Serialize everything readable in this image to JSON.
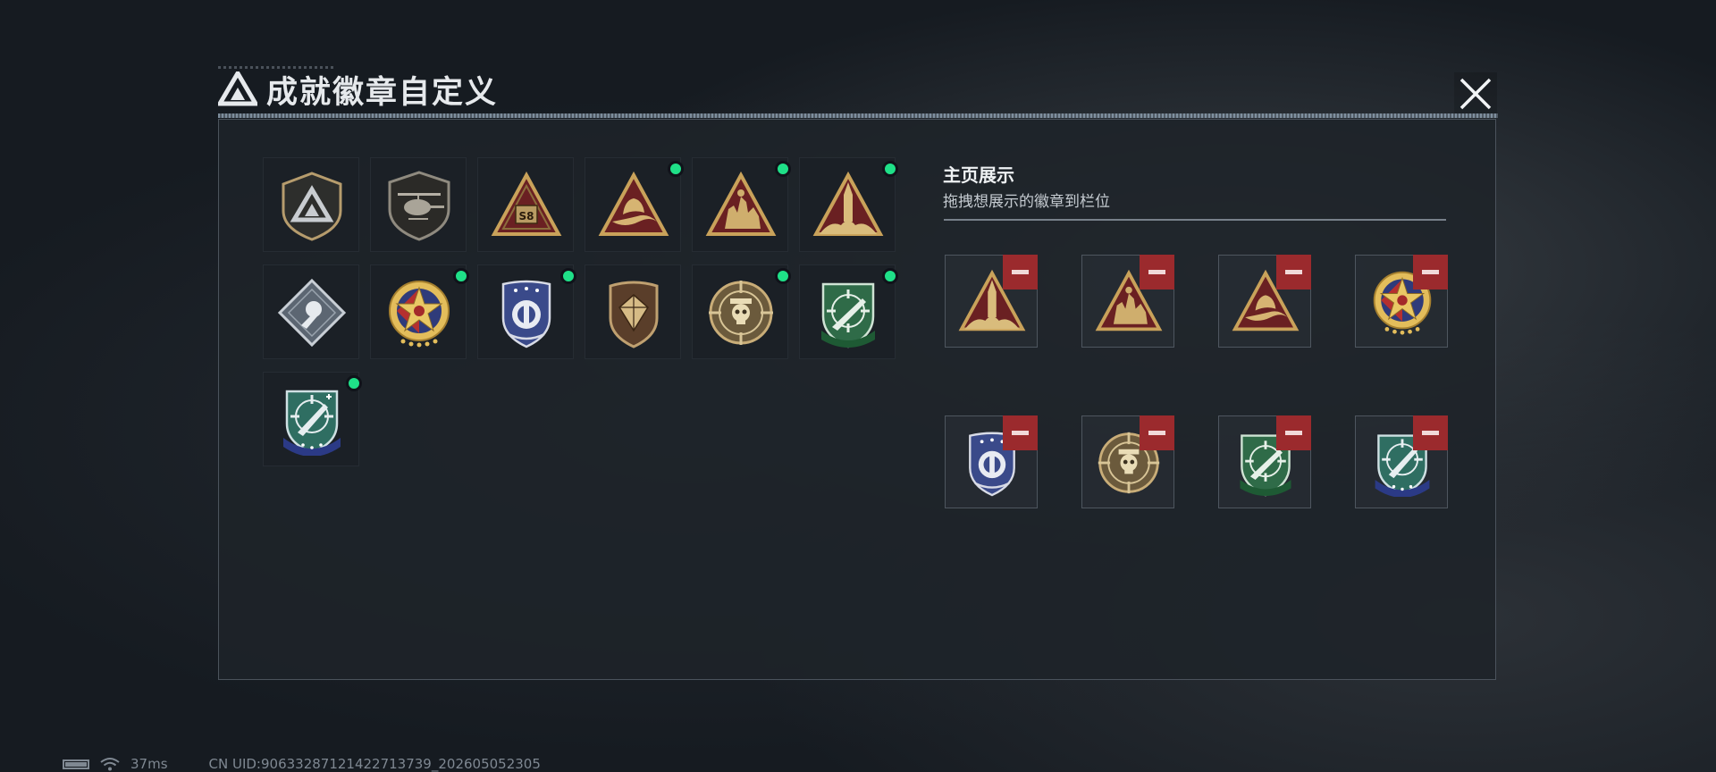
{
  "header": {
    "title": "成就徽章自定义"
  },
  "display_section": {
    "title": "主页展示",
    "subtitle": "拖拽想展示的徽章到栏位"
  },
  "inventory": [
    {
      "badge": "shield-mountain-badge",
      "new": false
    },
    {
      "badge": "helicopter-badge",
      "new": false
    },
    {
      "badge": "s8-triangle-badge",
      "new": false
    },
    {
      "badge": "hand-triangle-badge",
      "new": true
    },
    {
      "badge": "soldiers-triangle-badge",
      "new": true
    },
    {
      "badge": "rocket-triangle-badge",
      "new": true
    },
    {
      "badge": "rose-diamond-badge",
      "new": false
    },
    {
      "badge": "star-medal-badge",
      "new": true
    },
    {
      "badge": "police-shield-badge",
      "new": true
    },
    {
      "badge": "gem-shield-badge",
      "new": false
    },
    {
      "badge": "skull-crosshair-badge",
      "new": true
    },
    {
      "badge": "green-rifle-shield-badge",
      "new": true
    },
    {
      "badge": "blue-knife-shield-badge",
      "new": true
    }
  ],
  "display_slots": [
    {
      "badge": "rocket-triangle-badge"
    },
    {
      "badge": "soldiers-triangle-badge"
    },
    {
      "badge": "hand-triangle-badge"
    },
    {
      "badge": "star-medal-badge"
    },
    {
      "badge": "police-shield-badge"
    },
    {
      "badge": "skull-crosshair-badge"
    },
    {
      "badge": "green-rifle-shield-badge"
    },
    {
      "badge": "blue-knife-shield-badge"
    }
  ],
  "inventory_labels": {
    "s8_text": "S8"
  },
  "colors": {
    "accent_green": "#1fe088",
    "remove_red": "#9b2a2d",
    "gold": "#c9a25a"
  },
  "status_bar": {
    "ping": "37ms",
    "uid": "CN UID:9063328712142271373​9_202605052305"
  }
}
